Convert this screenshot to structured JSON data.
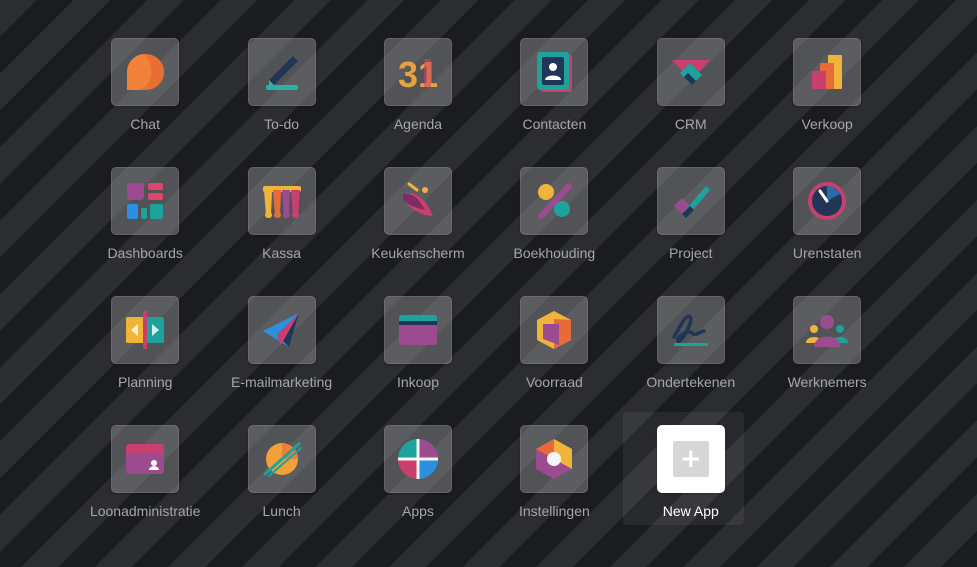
{
  "apps": [
    {
      "label": "Chat",
      "icon": "chat-icon"
    },
    {
      "label": "To-do",
      "icon": "todo-icon"
    },
    {
      "label": "Agenda",
      "icon": "calendar-icon",
      "icon_text": "31"
    },
    {
      "label": "Contacten",
      "icon": "contacts-icon"
    },
    {
      "label": "CRM",
      "icon": "crm-icon"
    },
    {
      "label": "Verkoop",
      "icon": "sales-icon"
    },
    {
      "label": "Dashboards",
      "icon": "dashboards-icon"
    },
    {
      "label": "Kassa",
      "icon": "point-of-sale-icon"
    },
    {
      "label": "Keukenscherm",
      "icon": "kitchen-display-icon"
    },
    {
      "label": "Boekhouding",
      "icon": "accounting-icon"
    },
    {
      "label": "Project",
      "icon": "project-icon"
    },
    {
      "label": "Urenstaten",
      "icon": "timesheets-icon"
    },
    {
      "label": "Planning",
      "icon": "planning-icon"
    },
    {
      "label": "E-mailmarketing",
      "icon": "email-marketing-icon"
    },
    {
      "label": "Inkoop",
      "icon": "purchase-icon"
    },
    {
      "label": "Voorraad",
      "icon": "inventory-icon"
    },
    {
      "label": "Ondertekenen",
      "icon": "sign-icon"
    },
    {
      "label": "Werknemers",
      "icon": "employees-icon"
    },
    {
      "label": "Loonadministratie",
      "icon": "payroll-icon"
    },
    {
      "label": "Lunch",
      "icon": "lunch-icon"
    },
    {
      "label": "Apps",
      "icon": "apps-icon"
    },
    {
      "label": "Instellingen",
      "icon": "settings-icon"
    },
    {
      "label": "New App",
      "icon": "plus-icon",
      "selected": true
    }
  ]
}
